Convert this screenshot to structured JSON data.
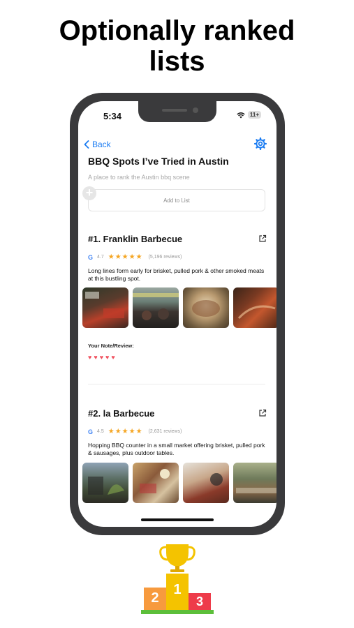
{
  "headline": {
    "line1": "Optionally ranked",
    "line2": "lists"
  },
  "status": {
    "time": "5:34",
    "battery": "11+"
  },
  "nav": {
    "back_label": "Back"
  },
  "list": {
    "title": "BBQ Spots I’ve Tried in Austin",
    "subtitle": "A place to rank the Austin bbq scene",
    "add_label": "Add to List"
  },
  "entries": [
    {
      "title": "#1. Franklin Barbecue",
      "rating": "4.7",
      "stars": "★★★★★",
      "reviews": "(5,196 reviews)",
      "description": "Long lines form early for brisket, pulled pork & other smoked meats at this bustling spot.",
      "note_label": "Your Note/Review:",
      "hearts": "♥♥♥♥♥"
    },
    {
      "title": "#2. la Barbecue",
      "rating": "4.5",
      "stars": "★★★★★",
      "reviews": "(2,631 reviews)",
      "description": "Hopping BBQ counter in a small market offering brisket, pulled pork & sausages, plus outdoor tables."
    }
  ],
  "podium": {
    "first": "1",
    "second": "2",
    "third": "3"
  },
  "colors": {
    "accent": "#1b7cf2",
    "star": "#f5a623",
    "heart": "#f0505e"
  }
}
